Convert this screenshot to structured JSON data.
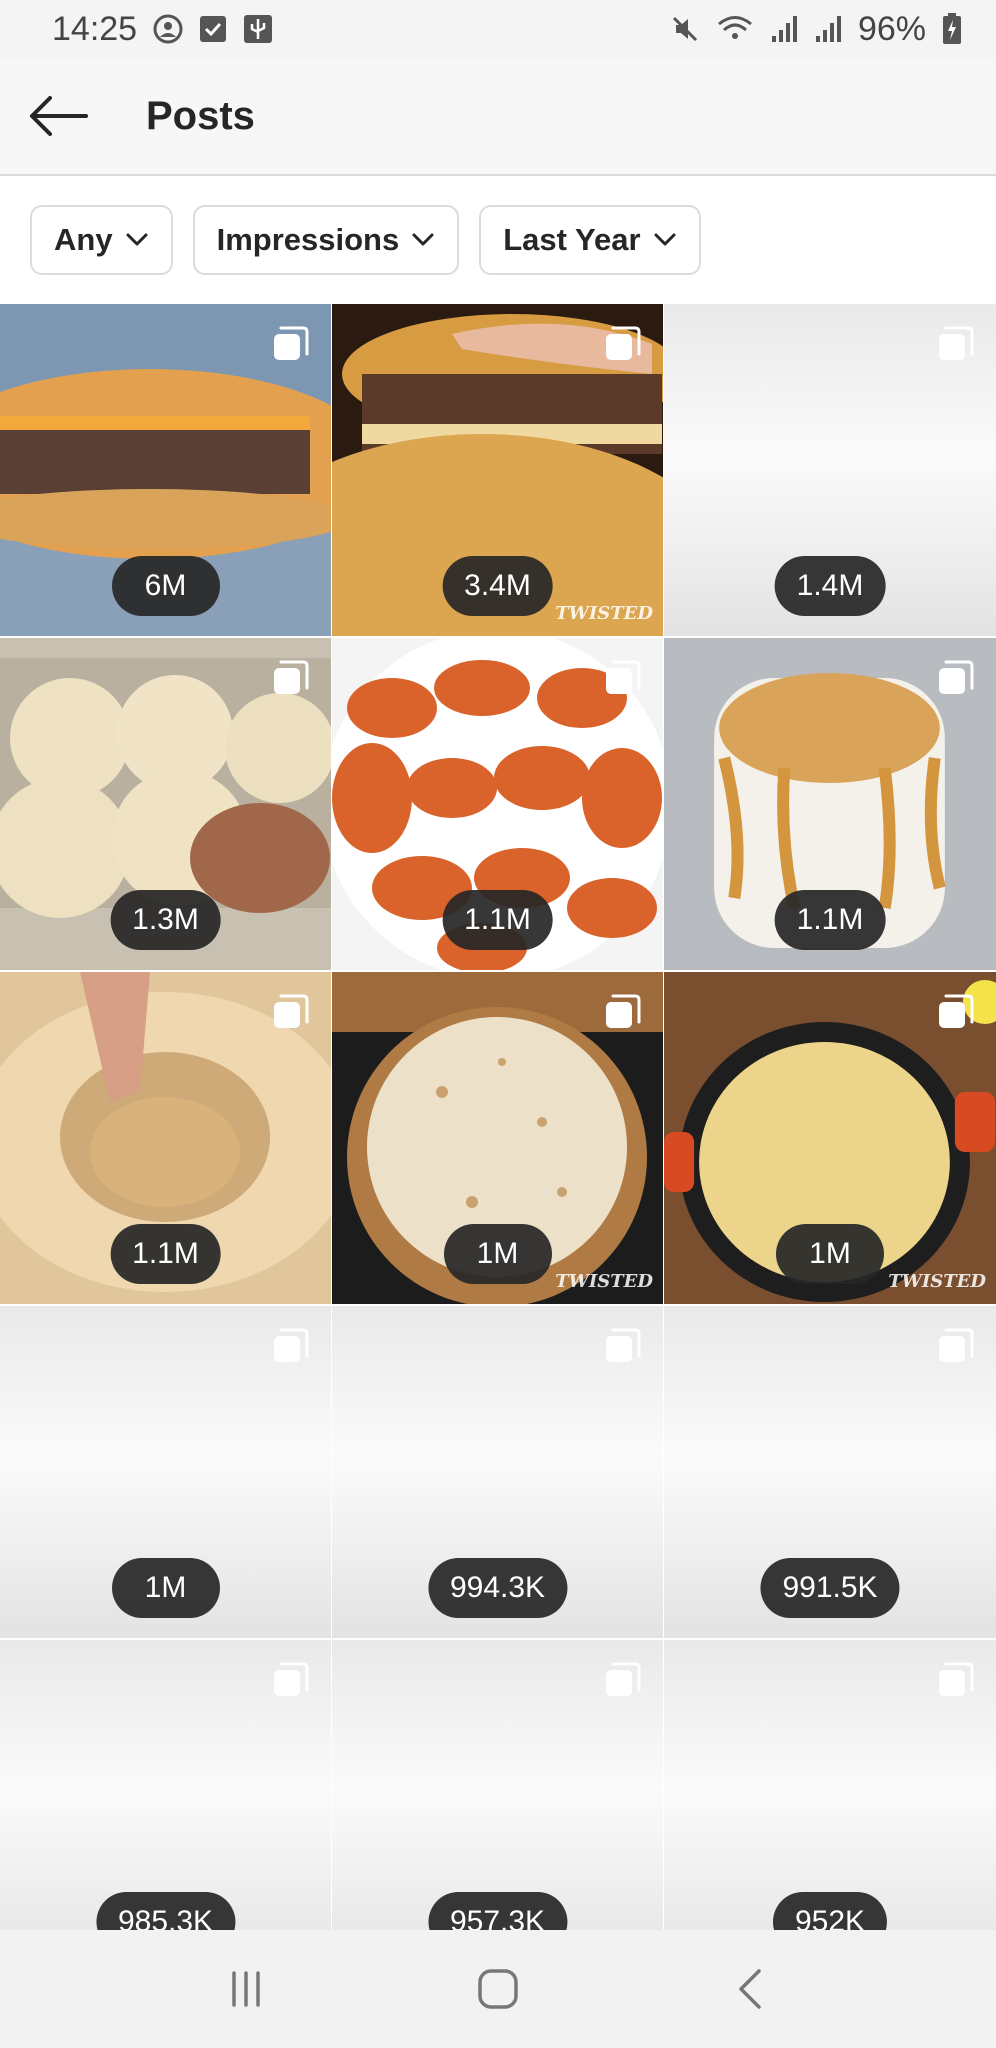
{
  "status_bar": {
    "time": "14:25",
    "battery": "96%",
    "left_icons": [
      "face-icon",
      "checkbox-icon",
      "usb-icon"
    ],
    "right_icons": [
      "mute-icon",
      "wifi-icon",
      "signal-icon",
      "signal-icon",
      "battery-charging-icon"
    ]
  },
  "header": {
    "title": "Posts",
    "back_icon": "arrow-left-icon"
  },
  "filters": [
    {
      "label": "Any"
    },
    {
      "label": "Impressions"
    },
    {
      "label": "Last Year"
    }
  ],
  "posts": [
    {
      "impressions": "6M",
      "thumbnail": "stuffed-burger-pastry"
    },
    {
      "impressions": "3.4M",
      "thumbnail": "sesame-bun-burger",
      "watermark": "TWISTED"
    },
    {
      "impressions": "1.4M",
      "thumbnail": "blank"
    },
    {
      "impressions": "1.3M",
      "thumbnail": "dough-balls-tray"
    },
    {
      "impressions": "1.1M",
      "thumbnail": "seasoned-chips-plate"
    },
    {
      "impressions": "1.1M",
      "thumbnail": "whipped-coffee-glass"
    },
    {
      "impressions": "1.1M",
      "thumbnail": "cheese-wheel-pasta"
    },
    {
      "impressions": "1M",
      "thumbnail": "tortilla-board",
      "watermark": "TWISTED"
    },
    {
      "impressions": "1M",
      "thumbnail": "penne-pot",
      "watermark": "TWISTED"
    },
    {
      "impressions": "1M",
      "thumbnail": "blank"
    },
    {
      "impressions": "994.3K",
      "thumbnail": "blank"
    },
    {
      "impressions": "991.5K",
      "thumbnail": "blank"
    },
    {
      "impressions": "985.3K",
      "thumbnail": "blank"
    },
    {
      "impressions": "957.3K",
      "thumbnail": "blank"
    },
    {
      "impressions": "952K",
      "thumbnail": "blank"
    }
  ],
  "nav_bar": {
    "buttons": [
      "recent-apps-icon",
      "home-icon",
      "back-icon"
    ]
  }
}
